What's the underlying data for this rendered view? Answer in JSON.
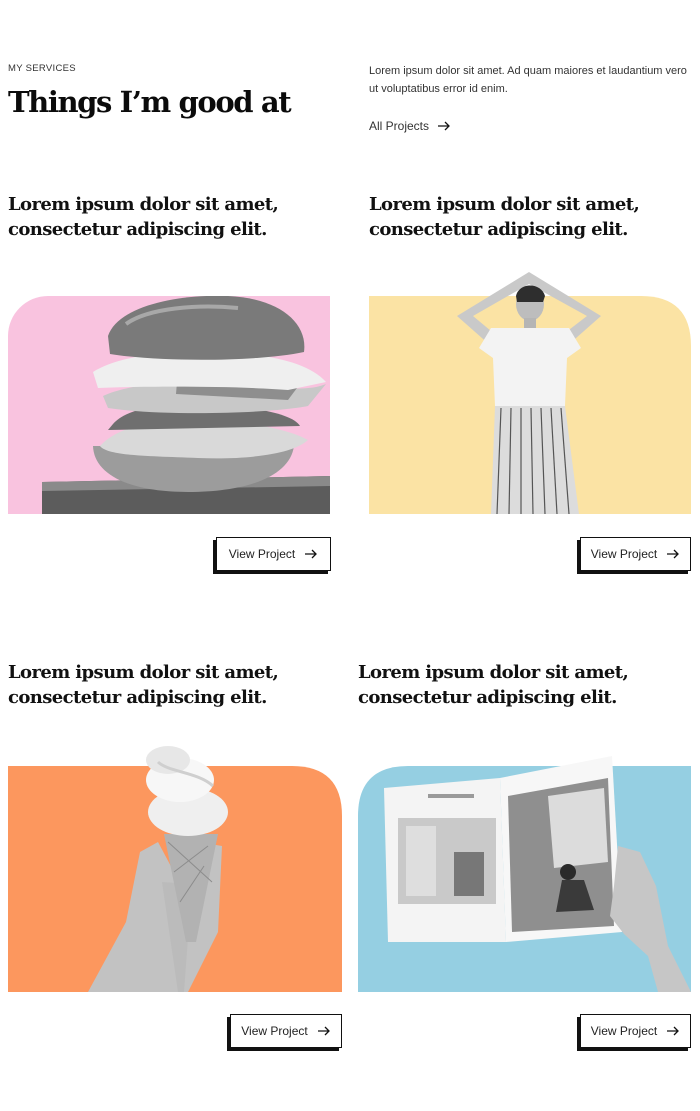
{
  "header": {
    "eyebrow": "MY SERVICES",
    "title": "Things I’m good at",
    "intro": "Lorem ipsum dolor sit amet. Ad quam maiores et laudantium vero ut voluptatibus error id enim.",
    "all_projects_label": "All Projects"
  },
  "colors": {
    "pink": "#f9c3df",
    "yellow": "#fbe3a4",
    "orange": "#fc975e",
    "blue": "#95cfe2"
  },
  "cards": [
    {
      "title": "Lorem ipsum dolor sit amet, consectetur adipiscing elit.",
      "image": "burger-photo",
      "bg": "#f9c3df",
      "button_label": "View Project"
    },
    {
      "title": "Lorem ipsum dolor sit amet, consectetur adipiscing elit.",
      "image": "woman-photo",
      "bg": "#fbe3a4",
      "button_label": "View Project"
    },
    {
      "title": "Lorem ipsum dolor sit amet, consectetur adipiscing elit.",
      "image": "ice-cream-photo",
      "bg": "#fc975e",
      "button_label": "View Project"
    },
    {
      "title": "Lorem ipsum dolor sit amet, consectetur adipiscing elit.",
      "image": "magazine-photo",
      "bg": "#95cfe2",
      "button_label": "View Project"
    }
  ]
}
